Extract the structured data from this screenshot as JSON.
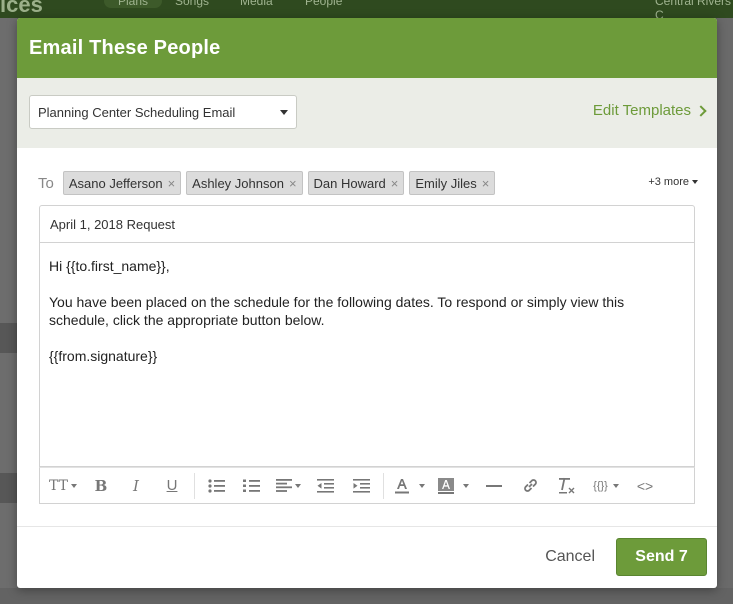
{
  "background": {
    "logo_text": "ices",
    "nav_tabs": [
      "Plans",
      "Songs",
      "Media",
      "People"
    ],
    "user_name": "Central Rivers C"
  },
  "modal": {
    "title": "Email These People",
    "template": {
      "selected": "Planning Center Scheduling Email",
      "edit_label": "Edit Templates"
    },
    "to": {
      "label": "To",
      "recipients": [
        "Asano Jefferson",
        "Ashley Johnson",
        "Dan Howard",
        "Emily Jiles"
      ],
      "remove_glyph": "×",
      "more_label": "+3 more"
    },
    "subject": "April 1, 2018 Request",
    "body": {
      "greeting": "Hi {{to.first_name}},",
      "paragraph": "You have been placed on the schedule for the following dates. To respond or simply view this schedule, click the appropriate button below.",
      "signature": "{{from.signature}}"
    },
    "toolbar": {
      "font_size": "TT",
      "bold": "B",
      "italic": "I",
      "underline": "U",
      "merge_fields": "{{}}",
      "code_view": "<>"
    },
    "footer": {
      "cancel_label": "Cancel",
      "send_label": "Send 7"
    }
  },
  "colors": {
    "accent": "#6d9b3a",
    "header_bg": "#6d9b3a",
    "template_bar_bg": "#ebede7"
  }
}
